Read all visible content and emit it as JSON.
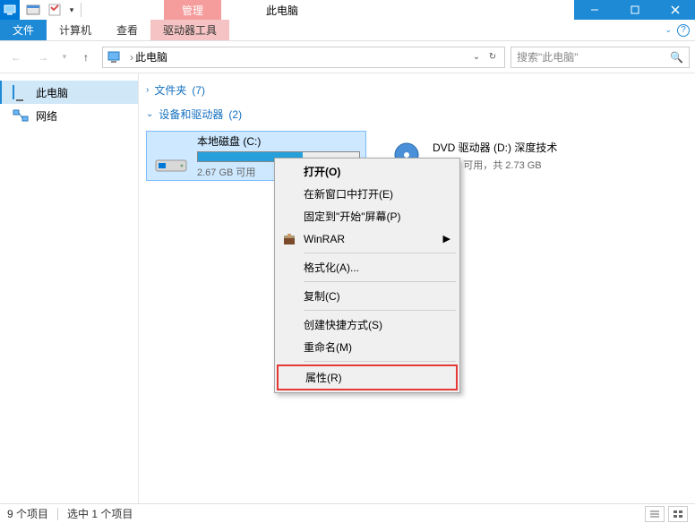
{
  "titlebar": {
    "contextual_label": "管理",
    "title": "此电脑"
  },
  "ribbon": {
    "file": "文件",
    "tabs": [
      "计算机",
      "查看"
    ],
    "contextual_tab": "驱动器工具"
  },
  "nav": {
    "breadcrumb_sep": "›",
    "location": "此电脑",
    "search_placeholder": "搜索\"此电脑\""
  },
  "sidebar": {
    "items": [
      {
        "label": "此电脑",
        "icon": "pc",
        "active": true
      },
      {
        "label": "网络",
        "icon": "net",
        "active": false
      }
    ]
  },
  "groups": {
    "folders": {
      "label": "文件夹",
      "count": "(7)"
    },
    "devices": {
      "label": "设备和驱动器",
      "count": "(2)"
    }
  },
  "drives": [
    {
      "name": "本地磁盘 (C:)",
      "sub": "2.67 GB 可用",
      "fill_pct": 65,
      "selected": true,
      "icon": "hdd"
    },
    {
      "name": "DVD 驱动器 (D:) 深度技术",
      "sub": "0 字节 可用，共 2.73 GB",
      "fill_pct": 100,
      "selected": false,
      "icon": "dvd"
    }
  ],
  "contextmenu": {
    "items": [
      {
        "label": "打开(O)",
        "bold": true
      },
      {
        "label": "在新窗口中打开(E)"
      },
      {
        "label": "固定到\"开始\"屏幕(P)"
      },
      {
        "label": "WinRAR",
        "submenu": true,
        "icon": "winrar"
      },
      {
        "sep": true
      },
      {
        "label": "格式化(A)..."
      },
      {
        "sep": true
      },
      {
        "label": "复制(C)"
      },
      {
        "sep": true
      },
      {
        "label": "创建快捷方式(S)"
      },
      {
        "label": "重命名(M)"
      },
      {
        "sep": true
      },
      {
        "label": "属性(R)",
        "highlighted": true
      }
    ]
  },
  "status": {
    "left": "9 个项目",
    "selection": "选中 1 个项目"
  }
}
